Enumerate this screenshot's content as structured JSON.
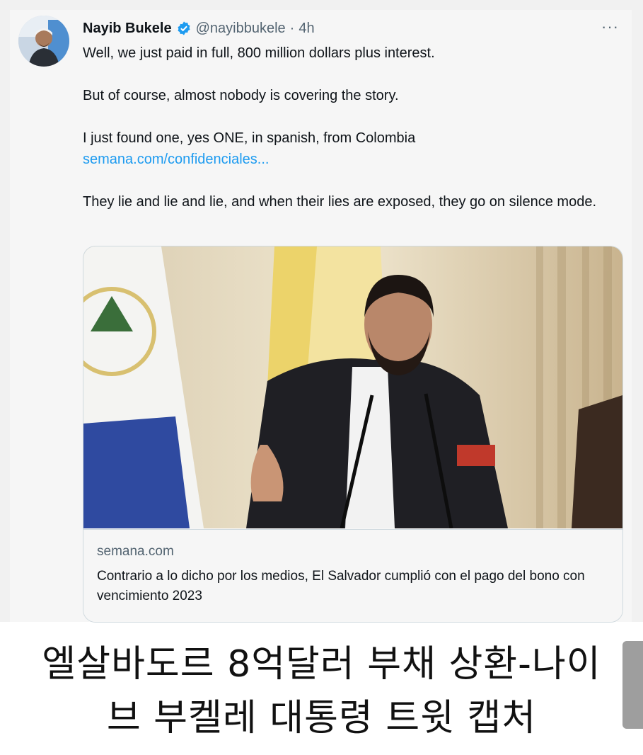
{
  "tweet": {
    "author_name": "Nayib Bukele",
    "handle": "@nayibbukele",
    "separator": "·",
    "time": "4h",
    "more_label": "···",
    "verified_icon": "verified-badge-icon",
    "lines": {
      "l1": "Well, we just paid in full, 800 million dollars plus interest.",
      "l2": "But of course, almost nobody is covering the story.",
      "l3": "I just found one, yes ONE, in spanish, from Colombia",
      "link": "semana.com/confidenciales...",
      "l4": "They lie and lie and lie, and when their lies are exposed, they go on silence mode."
    }
  },
  "card": {
    "domain": "semana.com",
    "title": "Contrario a lo dicho por los medios, El Salvador cumplió con el pago del bono con vencimiento 2023"
  },
  "caption": {
    "line1": "엘살바도르 8억달러 부채 상환-나이",
    "line2": "브 부켈레 대통령 트윗 캡처"
  },
  "colors": {
    "link": "#1d9bf0",
    "verified": "#1d9bf0",
    "text": "#0f1419",
    "secondary": "#536471"
  }
}
